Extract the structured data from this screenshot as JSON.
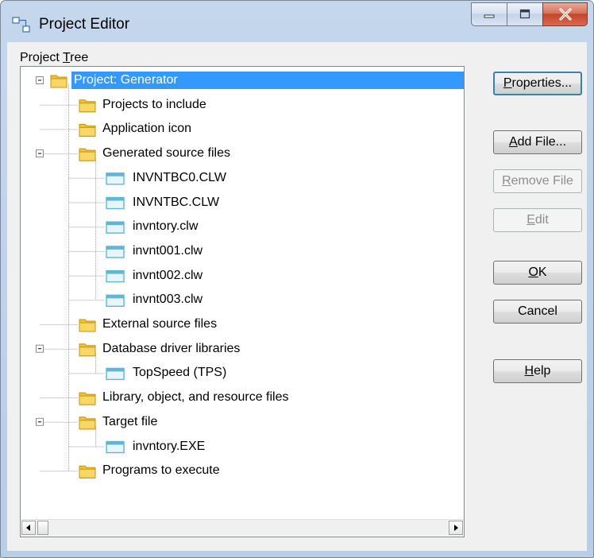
{
  "window": {
    "title": "Project Editor",
    "controls": {
      "minimize": "minimize-icon",
      "maximize": "maximize-icon",
      "close": "close-icon"
    }
  },
  "tree": {
    "label_pre": "Project ",
    "label_accel": "T",
    "label_post": "ree",
    "nodes": [
      {
        "label": "Project: Generator",
        "icon": "folder-icon",
        "level": 0,
        "selected": true,
        "expander": "minus"
      },
      {
        "label": "Projects to include",
        "icon": "folder-icon",
        "level": 1
      },
      {
        "label": "Application icon",
        "icon": "folder-icon",
        "level": 1
      },
      {
        "label": "Generated source files",
        "icon": "folder-icon",
        "level": 1,
        "expander": "minus"
      },
      {
        "label": "INVNTBC0.CLW",
        "icon": "file-icon",
        "level": 2
      },
      {
        "label": "INVNTBC.CLW",
        "icon": "file-icon",
        "level": 2
      },
      {
        "label": "invntory.clw",
        "icon": "file-icon",
        "level": 2
      },
      {
        "label": "invnt001.clw",
        "icon": "file-icon",
        "level": 2
      },
      {
        "label": "invnt002.clw",
        "icon": "file-icon",
        "level": 2
      },
      {
        "label": "invnt003.clw",
        "icon": "file-icon",
        "level": 2
      },
      {
        "label": "External source files",
        "icon": "folder-icon",
        "level": 1
      },
      {
        "label": "Database driver libraries",
        "icon": "folder-icon",
        "level": 1,
        "expander": "minus"
      },
      {
        "label": "TopSpeed (TPS)",
        "icon": "file-icon",
        "level": 2
      },
      {
        "label": "Library, object, and resource files",
        "icon": "folder-icon",
        "level": 1
      },
      {
        "label": "Target file",
        "icon": "folder-icon",
        "level": 1,
        "expander": "minus"
      },
      {
        "label": "invntory.EXE",
        "icon": "file-icon",
        "level": 2
      },
      {
        "label": "Programs to execute",
        "icon": "folder-icon",
        "level": 1
      }
    ]
  },
  "buttons": {
    "properties": {
      "accel": "P",
      "rest": "roperties..."
    },
    "add_file": {
      "accel": "A",
      "rest": "dd File..."
    },
    "remove_file": {
      "accel": "R",
      "rest": "emove File"
    },
    "edit": {
      "accel": "E",
      "rest": "dit"
    },
    "ok": {
      "accel": "O",
      "rest": "K"
    },
    "cancel": {
      "label": "Cancel"
    },
    "help": {
      "accel": "H",
      "rest": "elp"
    }
  },
  "colors": {
    "selection": "#3399ff",
    "folder": "#f2c230",
    "file": "#5fb6d9"
  }
}
